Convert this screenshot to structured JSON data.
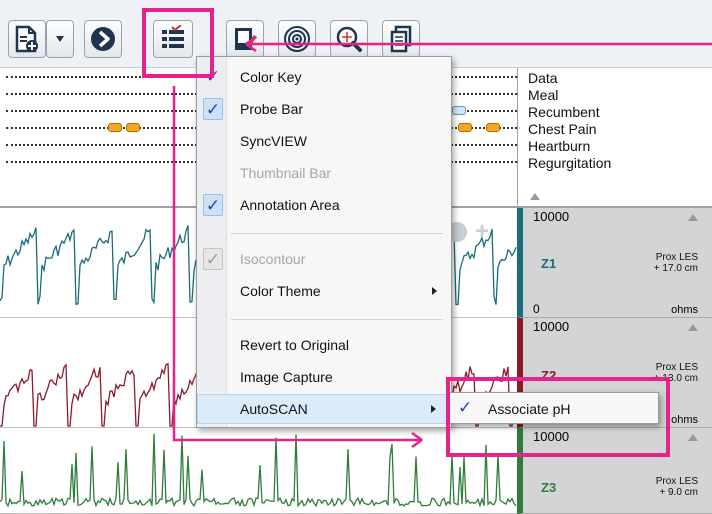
{
  "toolbar": {
    "buttons": [
      "new-study-icon",
      "dropdown-arrow-icon",
      "next-icon",
      "annotation-menu-icon",
      "edit-icon",
      "target-icon",
      "zoom-icon",
      "copy-icon"
    ]
  },
  "events": {
    "legend": [
      "Data",
      "Meal",
      "Recumbent",
      "Chest Pain",
      "Heartburn",
      "Regurgitation"
    ]
  },
  "menu": {
    "items": [
      {
        "label": "Color Key",
        "checked": true
      },
      {
        "label": "Probe Bar",
        "checked": true
      },
      {
        "label": "SyncVIEW",
        "checked": false
      },
      {
        "label": "Thumbnail Bar",
        "checked": false,
        "disabled": true
      },
      {
        "label": "Annotation Area",
        "checked": true
      },
      {
        "label": "Isocontour",
        "checked": true,
        "disabled": true
      },
      {
        "label": "Color Theme",
        "submenu": true
      },
      {
        "label": "Revert to Original"
      },
      {
        "label": "Image Capture"
      },
      {
        "label": "AutoSCAN",
        "submenu": true,
        "highlighted": true
      }
    ],
    "check_glyph": "✓"
  },
  "submenu": {
    "label": "Associate pH",
    "check_glyph": "✓"
  },
  "channels": [
    {
      "name": "Z1",
      "max": "10000",
      "min": "0",
      "unit": "ohms",
      "location_line1": "Prox LES",
      "location_line2": "+ 17.0 cm",
      "color": "#1b6c7a"
    },
    {
      "name": "Z2",
      "max": "10000",
      "min": "",
      "unit": "ohms",
      "location_line1": "Prox LES",
      "location_line2": "+ 13.0 cm",
      "color": "#8b1a2b"
    },
    {
      "name": "Z3",
      "max": "10000",
      "min": "",
      "unit": "",
      "location_line1": "Prox LES",
      "location_line2": "+ 9.0 cm",
      "color": "#2e7d3b"
    }
  ],
  "colors": {
    "callout": "#e6238a",
    "check": "#2345b8",
    "event_marker": "#f5a623"
  }
}
